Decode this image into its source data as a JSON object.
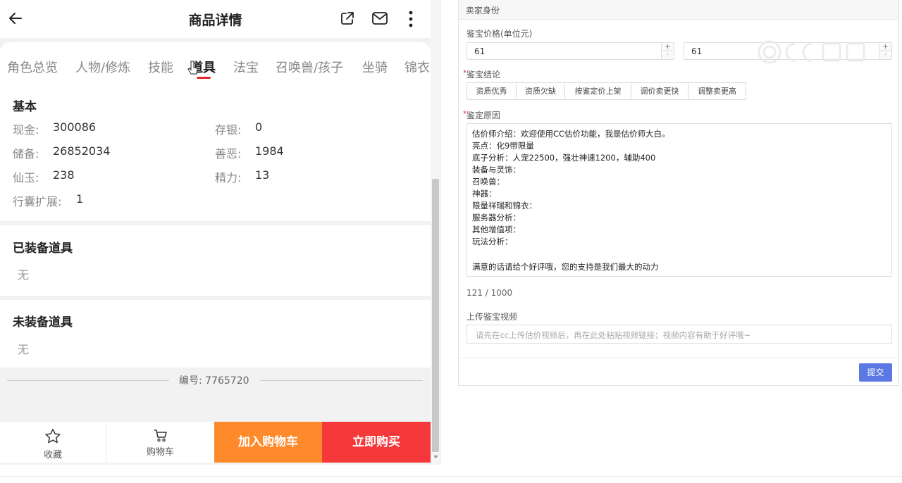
{
  "phone": {
    "title": "商品详情",
    "tabs": [
      "角色总览",
      "人物/修炼",
      "技能",
      "道具",
      "法宝",
      "召唤兽/孩子",
      "坐骑",
      "锦衣"
    ],
    "active_tab": "道具",
    "basic": {
      "title": "基本",
      "left": [
        {
          "label": "现金:",
          "value": "300086"
        },
        {
          "label": "储备:",
          "value": "26852034"
        },
        {
          "label": "仙玉:",
          "value": "238"
        },
        {
          "label": "行囊扩展:",
          "value": "1"
        }
      ],
      "right": [
        {
          "label": "存银:",
          "value": "0"
        },
        {
          "label": "善恶:",
          "value": "1984"
        },
        {
          "label": "精力:",
          "value": "13"
        }
      ]
    },
    "equipped": {
      "title": "已装备道具",
      "empty": "无"
    },
    "unequipped": {
      "title": "未装备道具",
      "empty": "无"
    },
    "serial": "编号: 7765720",
    "bottom": {
      "favorite": "收藏",
      "cart": "购物车",
      "add_to_cart": "加入购物车",
      "buy_now": "立即购买"
    }
  },
  "form": {
    "header": "卖家身份",
    "price_label": "鉴宝价格(单位元)",
    "price_min": "61",
    "price_max": "61",
    "spin_up": "+",
    "spin_down": "-",
    "conclusion_label": "鉴宝结论",
    "conclusion_options": [
      "资质优秀",
      "资质欠缺",
      "按鉴定价上架",
      "调价卖更快",
      "调整卖更高"
    ],
    "reason_label": "鉴定原因",
    "reason_lines": [
      "估价师介绍：欢迎使用CC估价功能，我是估价师大白。",
      "亮点：化9带限量",
      "底子分析：人宠22500，强壮神速1200，辅助400",
      "装备与灵饰：",
      "召唤兽：",
      "神器：",
      "限量祥瑞和锦衣：",
      "服务器分析：",
      "其他增值项：",
      "玩法分析：",
      "",
      "满意的话请给个好评哦，您的支持是我们最大的动力"
    ],
    "char_count": "121 / 1000",
    "video_label": "上传鉴宝视频",
    "video_placeholder": "请先在cc上传估价视频后，再在此处粘贴视频链接；视频内容有助于好评哦~",
    "submit": "提交",
    "required_mark": "*"
  },
  "watermark": "CC网游"
}
